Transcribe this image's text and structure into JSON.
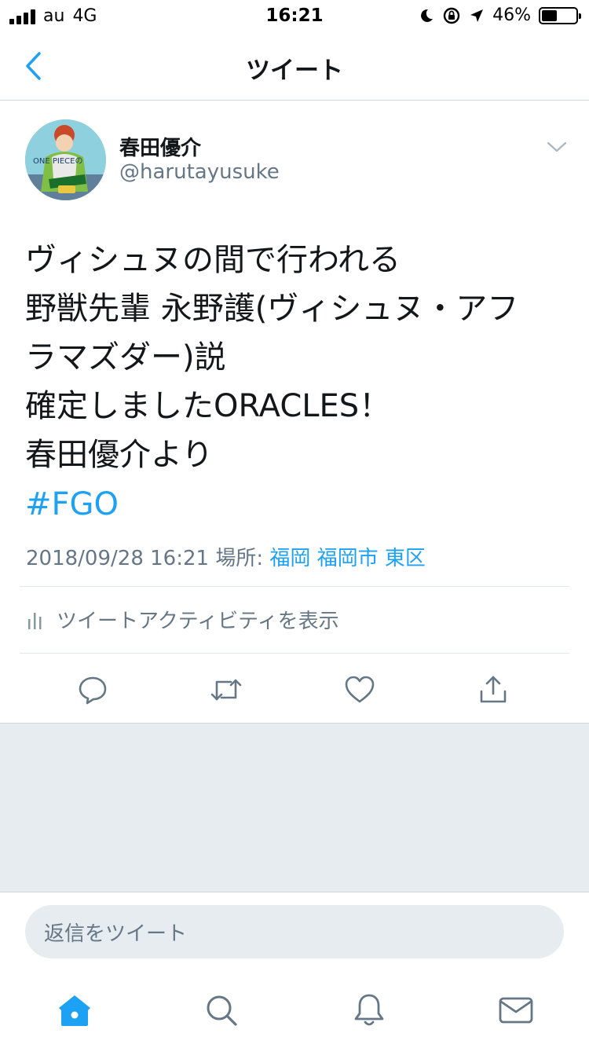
{
  "status_bar": {
    "carrier": "au",
    "network": "4G",
    "time": "16:21",
    "battery_percent": "46%",
    "battery_level": 0.46,
    "icons": [
      "signal-icon",
      "moon-icon",
      "rotation-lock-icon",
      "location-arrow-icon",
      "battery-icon"
    ]
  },
  "nav": {
    "title": "ツイート",
    "back_icon": "chevron-left-icon"
  },
  "tweet": {
    "display_name": "春田優介",
    "handle": "@harutayusuke",
    "avatar_text": "ONE PIECEの",
    "text_lines": [
      "ヴィシュヌの間で行われる",
      "野獣先輩 永野護(ヴィシュヌ・アフ",
      "ラマズダー)説",
      "確定しましたORACLES！",
      "春田優介より"
    ],
    "hashtag": "#FGO",
    "timestamp": "2018/09/28 16:21",
    "location_label": "場所:",
    "location": "福岡 福岡市 東区",
    "activity_label": "ツイートアクティビティを表示"
  },
  "actions": [
    "reply-icon",
    "retweet-icon",
    "like-icon",
    "share-icon"
  ],
  "reply": {
    "placeholder": "返信をツイート"
  },
  "tabs": [
    "home-icon",
    "search-icon",
    "notifications-icon",
    "messages-icon"
  ],
  "colors": {
    "accent": "#1da1f2",
    "secondary_text": "#657786",
    "background_gray": "#e6ecf0"
  }
}
